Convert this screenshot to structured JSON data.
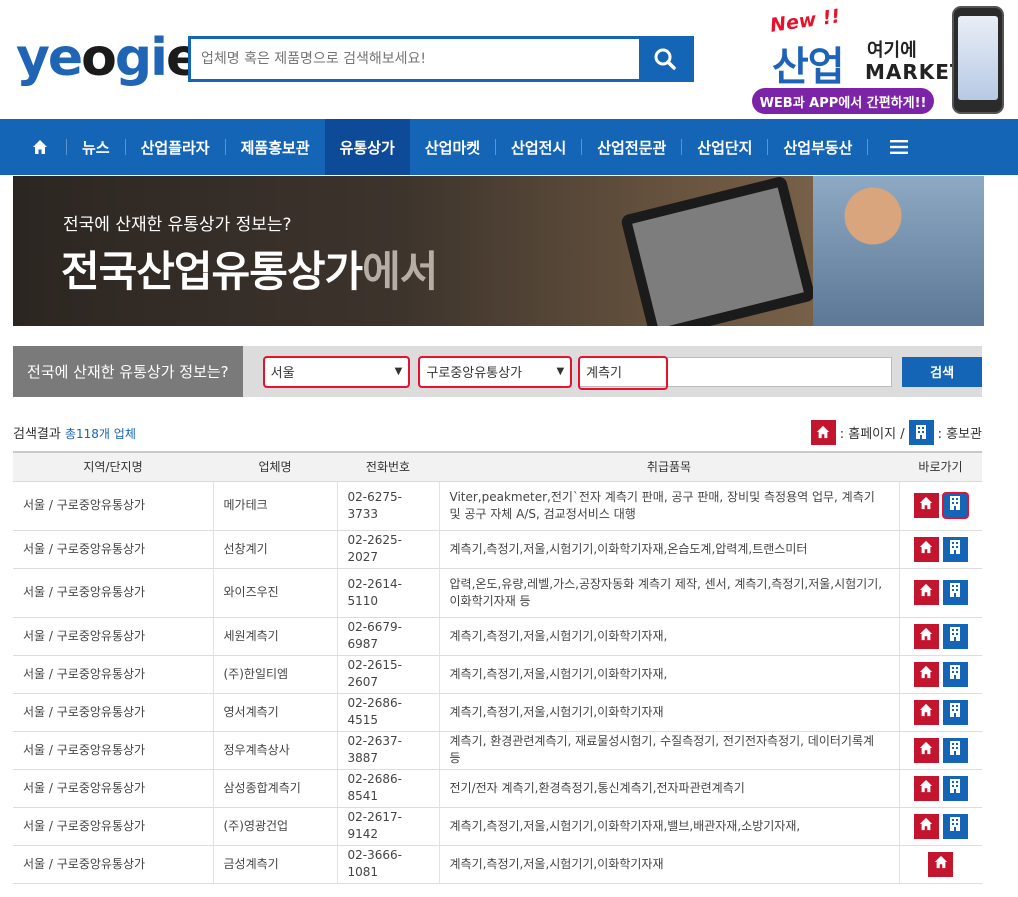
{
  "header": {
    "logo_text": "yeogie",
    "search_placeholder": "업체명 혹은 제품명으로 검색해보세요!",
    "search_icon": "search-icon",
    "promo": {
      "new_label": "New !!",
      "title_big": "산업",
      "title_small": "여기에",
      "title_market": "MARKET",
      "pill_text": "WEB과 APP에서 간편하게!!"
    }
  },
  "nav": {
    "home_icon": "home-icon",
    "items": [
      "뉴스",
      "산업플라자",
      "제품홍보관",
      "유통상가",
      "산업마켓",
      "산업전시",
      "산업전문관",
      "산업단지",
      "산업부동산"
    ],
    "active_index": 3,
    "menu_icon": "menu-icon"
  },
  "banner": {
    "line1": "전국에 산재한 유통상가 정보는?",
    "line2_main": "전국산업유통상가",
    "line2_dim": "에서"
  },
  "filter": {
    "label": "전국에 산재한 유통상가 정보는?",
    "region": "서울",
    "mall": "구로중앙유통상가",
    "keyword": "계측기",
    "button": "검색"
  },
  "results": {
    "prefix": "검색결과",
    "count": "총118개 업체",
    "legend_home": ": 홈페이지 /",
    "legend_promo": ": 홍보관"
  },
  "table": {
    "headers": [
      "지역/단지명",
      "업체명",
      "전화번호",
      "취급품목",
      "바로가기"
    ],
    "rows": [
      {
        "region": "서울 / 구로중앙유통상가",
        "name": "메가테크",
        "phone": "02-6275-3733",
        "items": "Viter,peakmeter,전기`전자 계측기 판매, 공구 판매, 장비및 측정용역 업무, 계측기 및 공구 자체 A/S, 검교정서비스 대행",
        "home": true,
        "promo": true
      },
      {
        "region": "서울 / 구로중앙유통상가",
        "name": "선창계기",
        "phone": "02-2625-2027",
        "items": "계측기,측정기,저울,시험기기,이화학기자재,온습도계,압력계,트랜스미터",
        "home": true,
        "promo": true
      },
      {
        "region": "서울 / 구로중앙유통상가",
        "name": "와이즈우진",
        "phone": "02-2614-5110",
        "items": "압력,온도,유량,레벨,가스,공장자동화 계측기 제작, 센서, 계측기,측정기,저울,시험기기,이화학기자재 등",
        "home": true,
        "promo": true
      },
      {
        "region": "서울 / 구로중앙유통상가",
        "name": "세원계측기",
        "phone": "02-6679-6987",
        "items": "계측기,측정기,저울,시험기기,이화학기자재,",
        "home": true,
        "promo": true
      },
      {
        "region": "서울 / 구로중앙유통상가",
        "name": "(주)한일티엠",
        "phone": "02-2615-2607",
        "items": "계측기,측정기,저울,시험기기,이화학기자재,",
        "home": true,
        "promo": true
      },
      {
        "region": "서울 / 구로중앙유통상가",
        "name": "영서계측기",
        "phone": "02-2686-4515",
        "items": "계측기,측정기,저울,시험기기,이화학기자재",
        "home": true,
        "promo": true
      },
      {
        "region": "서울 / 구로중앙유통상가",
        "name": "정우계측상사",
        "phone": "02-2637-3887",
        "items": "계측기, 환경관련계측기, 재료물성시험기, 수질측정기, 전기전자측정기, 데이터기록계 등",
        "home": true,
        "promo": true
      },
      {
        "region": "서울 / 구로중앙유통상가",
        "name": "삼성종합계측기",
        "phone": "02-2686-8541",
        "items": "전기/전자 계측기,환경측정기,통신계측기,전자파관련계측기",
        "home": true,
        "promo": true
      },
      {
        "region": "서울 / 구로중앙유통상가",
        "name": "(주)영광건업",
        "phone": "02-2617-9142",
        "items": "계측기,측정기,저울,시험기기,이화학기자재,밸브,배관자재,소방기자재,",
        "home": true,
        "promo": true
      },
      {
        "region": "서울 / 구로중앙유통상가",
        "name": "금성계측기",
        "phone": "02-3666-1081",
        "items": "계측기,측정기,저울,시험기기,이화학기자재",
        "home": true,
        "promo": false
      }
    ]
  }
}
